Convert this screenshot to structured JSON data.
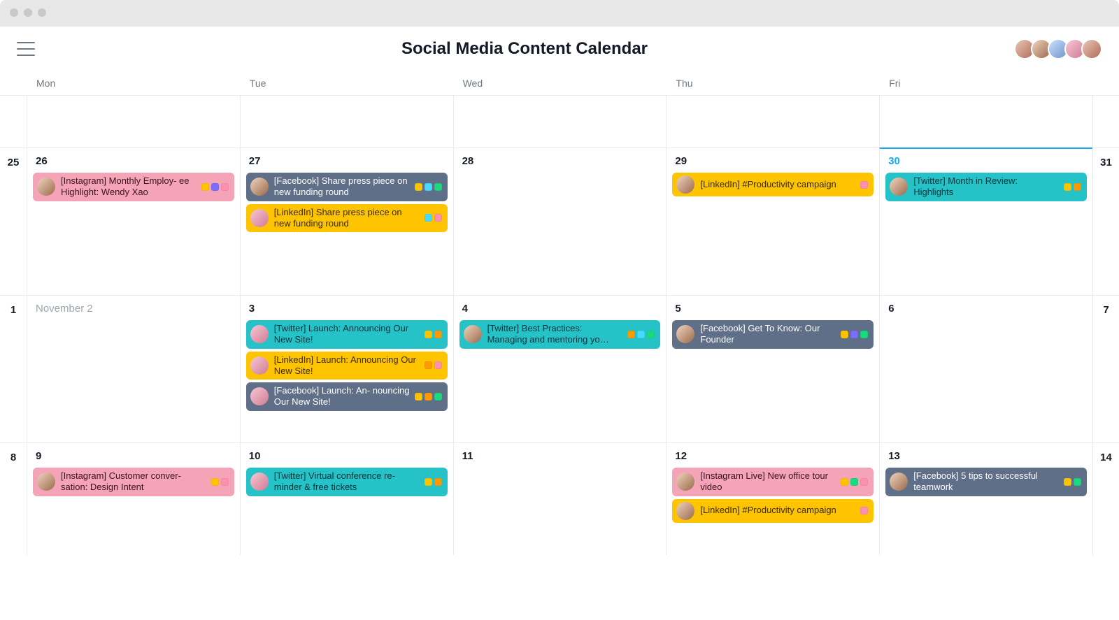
{
  "page": {
    "title": "Social Media Content Calendar"
  },
  "weekdays": [
    "Mon",
    "Tue",
    "Wed",
    "Thu",
    "Fri"
  ],
  "header_avatars": [
    "p1",
    "p3",
    "p2",
    "p5",
    "p1"
  ],
  "tagColors": {
    "yellow": "#ffc400",
    "orange": "#fd9a00",
    "indigo": "#796eff",
    "pink": "#fc91ad",
    "lblue": "#48dafd",
    "green": "#19db7e"
  },
  "cardColors": {
    "pink": "#f5a3b7",
    "yellow": "#ffc400",
    "teal": "#25c2c8",
    "slate": "#5f6f87"
  },
  "weeks": [
    {
      "leftGutter": "",
      "rightGutter": "",
      "days": [
        {
          "label": "",
          "tasks": []
        },
        {
          "label": "",
          "tasks": []
        },
        {
          "label": "",
          "tasks": []
        },
        {
          "label": "",
          "tasks": []
        },
        {
          "label": "",
          "tasks": []
        }
      ]
    },
    {
      "leftGutter": "25",
      "rightGutter": "31",
      "days": [
        {
          "label": "26",
          "tasks": [
            {
              "color": "pink",
              "avatar": "p3",
              "text": "[Instagram] Monthly Employ-\nee Highlight: Wendy Xao",
              "tags": [
                "yellow",
                "indigo",
                "pink"
              ]
            }
          ]
        },
        {
          "label": "27",
          "tasks": [
            {
              "color": "slate",
              "avatar": "p3",
              "text": "[Facebook] Share press piece on new funding round",
              "tags": [
                "yellow",
                "lblue",
                "green"
              ]
            },
            {
              "color": "yellow",
              "avatar": "p5",
              "text": "[LinkedIn] Share press piece on new funding round",
              "tags": [
                "lblue",
                "pink"
              ]
            }
          ]
        },
        {
          "label": "28",
          "tasks": []
        },
        {
          "label": "29",
          "tasks": [
            {
              "color": "yellow",
              "avatar": "p3",
              "text": "[LinkedIn] #Productivity campaign",
              "tags": [
                "pink"
              ]
            }
          ]
        },
        {
          "label": "30",
          "today": true,
          "tasks": [
            {
              "color": "teal",
              "avatar": "p3",
              "text": "[Twitter] Month in Review: Highlights",
              "tags": [
                "yellow",
                "orange"
              ]
            }
          ]
        }
      ]
    },
    {
      "leftGutter": "1",
      "rightGutter": "7",
      "days": [
        {
          "label": "November 2",
          "muted": true,
          "tasks": []
        },
        {
          "label": "3",
          "tasks": [
            {
              "color": "teal",
              "avatar": "p5",
              "text": "[Twitter] Launch: Announcing Our New Site!",
              "tags": [
                "yellow",
                "orange"
              ]
            },
            {
              "color": "yellow",
              "avatar": "p5",
              "text": "[LinkedIn] Launch: Announcing Our New Site!",
              "tags": [
                "orange",
                "pink"
              ]
            },
            {
              "color": "slate",
              "avatar": "p5",
              "text": "[Facebook] Launch: An-\nnouncing Our New Site!",
              "tags": [
                "yellow",
                "orange",
                "green"
              ]
            }
          ]
        },
        {
          "label": "4",
          "tasks": [
            {
              "color": "teal",
              "avatar": "p3",
              "text": "[Twitter] Best Practices: Managing and mentoring yo…",
              "tags": [
                "orange",
                "lblue",
                "green"
              ]
            }
          ]
        },
        {
          "label": "5",
          "tasks": [
            {
              "color": "slate",
              "avatar": "p3",
              "text": "[Facebook] Get To Know: Our Founder",
              "tags": [
                "yellow",
                "indigo",
                "green"
              ]
            }
          ]
        },
        {
          "label": "6",
          "tasks": []
        }
      ]
    },
    {
      "leftGutter": "8",
      "rightGutter": "14",
      "days": [
        {
          "label": "9",
          "tasks": [
            {
              "color": "pink",
              "avatar": "p3",
              "text": "[Instagram] Customer conver-\nsation: Design Intent",
              "tags": [
                "yellow",
                "pink"
              ]
            }
          ]
        },
        {
          "label": "10",
          "tasks": [
            {
              "color": "teal",
              "avatar": "p5",
              "text": "[Twitter] Virtual conference re-\nminder & free tickets",
              "tags": [
                "yellow",
                "orange"
              ]
            }
          ]
        },
        {
          "label": "11",
          "tasks": []
        },
        {
          "label": "12",
          "tasks": [
            {
              "color": "pink",
              "avatar": "p3",
              "text": "[Instagram Live] New office tour video",
              "tags": [
                "yellow",
                "green",
                "pink"
              ]
            },
            {
              "color": "yellow",
              "avatar": "p3",
              "text": "[LinkedIn] #Productivity campaign",
              "tags": [
                "pink"
              ]
            }
          ]
        },
        {
          "label": "13",
          "tasks": [
            {
              "color": "slate",
              "avatar": "p3",
              "text": "[Facebook] 5 tips to successful teamwork",
              "tags": [
                "yellow",
                "green"
              ]
            }
          ]
        }
      ]
    }
  ]
}
